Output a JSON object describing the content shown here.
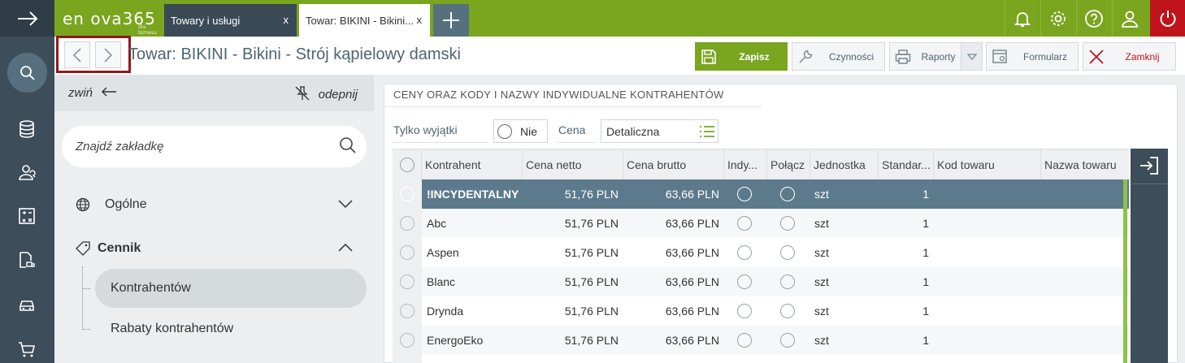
{
  "app": {
    "logo_text": "en ova365",
    "logo_sub": "dla biznesu"
  },
  "tabs": [
    {
      "label": "Towary i usługi",
      "close": "x"
    },
    {
      "label": "Towar: BIKINI - Bikini...",
      "close": "x"
    }
  ],
  "page": {
    "title": "Towar: BIKINI - Bikini - Strój kąpielowy damski"
  },
  "actions": {
    "save": "Zapisz",
    "czynnosci": "Czynności",
    "raporty": "Raporty",
    "formularz": "Formularz",
    "zamknij": "Zamknij"
  },
  "sidebar": {
    "collapse": "zwiń",
    "unpin": "odepnij",
    "search_placeholder": "Znajdź zakładkę",
    "groups": [
      {
        "label": "Ogólne"
      },
      {
        "label": "Cennik"
      }
    ],
    "subitems": [
      {
        "label": "Kontrahentów"
      },
      {
        "label": "Rabaty kontrahentów"
      }
    ]
  },
  "panel": {
    "title": "CENY ORAZ KODY I NAZWY INDYWIDUALNE KONTRAHENTÓW",
    "filter_only_exceptions": "Tylko wyjątki",
    "filter_only_exceptions_value": "Nie",
    "filter_price": "Cena",
    "filter_price_value": "Detaliczna"
  },
  "table": {
    "headers": [
      "Kontrahent",
      "Cena netto",
      "Cena brutto",
      "Indy...",
      "Połącz",
      "Jednostka",
      "Standar...",
      "Kod towaru",
      "Nazwa towaru"
    ],
    "rows": [
      {
        "kontrahent": "!INCYDENTALNY",
        "netto": "51,76 PLN",
        "brutto": "63,66 PLN",
        "jednostka": "szt",
        "standard": "1"
      },
      {
        "kontrahent": "Abc",
        "netto": "51,76 PLN",
        "brutto": "63,66 PLN",
        "jednostka": "szt",
        "standard": "1"
      },
      {
        "kontrahent": "Aspen",
        "netto": "51,76 PLN",
        "brutto": "63,66 PLN",
        "jednostka": "szt",
        "standard": "1"
      },
      {
        "kontrahent": "Blanc",
        "netto": "51,76 PLN",
        "brutto": "63,66 PLN",
        "jednostka": "szt",
        "standard": "1"
      },
      {
        "kontrahent": "Drynda",
        "netto": "51,76 PLN",
        "brutto": "63,66 PLN",
        "jednostka": "szt",
        "standard": "1"
      },
      {
        "kontrahent": "EnergoEko",
        "netto": "51,76 PLN",
        "brutto": "63,66 PLN",
        "jednostka": "szt",
        "standard": "1"
      }
    ]
  },
  "colors": {
    "brand_green": "#7aa51f",
    "dark_rail": "#3d4d59",
    "selected_row": "#5d7a8c",
    "power_red": "#c0141c",
    "highlight_frame": "#8e1a1f"
  },
  "icons": {
    "menu": "arrow-right-icon",
    "search": "search-icon",
    "notifications": "bell-icon",
    "settings": "gear-icon",
    "help": "question-icon",
    "user": "user-icon",
    "power": "power-icon"
  }
}
